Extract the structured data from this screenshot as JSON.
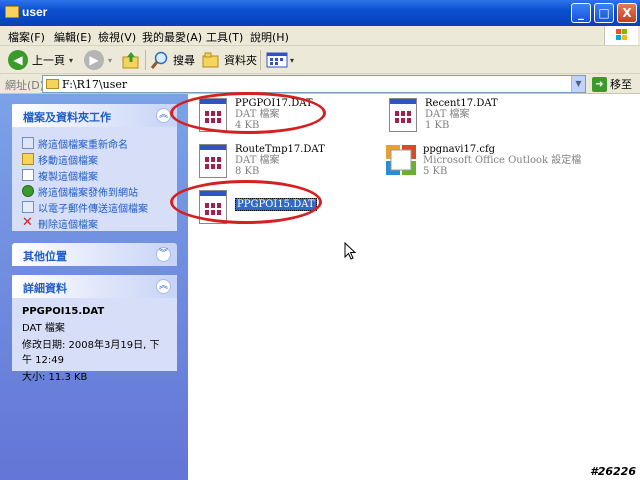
{
  "window": {
    "title": "user",
    "minimize": "_",
    "maximize": "□",
    "close": "X"
  },
  "menu": [
    "檔案(F)",
    "編輯(E)",
    "檢視(V)",
    "我的最愛(A)",
    "工具(T)",
    "說明(H)"
  ],
  "toolbar": {
    "back": "上一頁",
    "search": "搜尋",
    "folders": "資料夾"
  },
  "address": {
    "label": "網址(D)",
    "path": "F:\\R17\\user",
    "go": "移至"
  },
  "tasks_panel": {
    "title": "檔案及資料夾工作",
    "items": [
      {
        "label": "將這個檔案重新命名",
        "icon": "rename-icon"
      },
      {
        "label": "移動這個檔案",
        "icon": "move-icon"
      },
      {
        "label": "複製這個檔案",
        "icon": "copy-icon"
      },
      {
        "label": "將這個檔案發佈到網站",
        "icon": "globe-icon"
      },
      {
        "label": "以電子郵件傳送這個檔案",
        "icon": "email-icon"
      },
      {
        "label": "刪除這個檔案",
        "icon": "delete-icon"
      }
    ]
  },
  "other_places": {
    "title": "其他位置"
  },
  "details": {
    "title": "詳細資料",
    "name": "PPGPOI15.DAT",
    "type": "DAT 檔案",
    "modified": "修改日期: 2008年3月19日, 下午 12:49",
    "size": "大小: 11.3 KB"
  },
  "files": [
    {
      "name": "PPGPOI17.DAT",
      "type": "DAT 檔案",
      "size": "4 KB",
      "icon": "dat-file-icon"
    },
    {
      "name": "Recent17.DAT",
      "type": "DAT 檔案",
      "size": "1 KB",
      "icon": "dat-file-icon"
    },
    {
      "name": "RouteTmp17.DAT",
      "type": "DAT 檔案",
      "size": "8 KB",
      "icon": "dat-file-icon"
    },
    {
      "name": "ppgnavi17.cfg",
      "type": "Microsoft Office Outlook 設定檔",
      "size": "5 KB",
      "icon": "office-file-icon"
    },
    {
      "name": "PPGPOI15.DAT",
      "type": "",
      "size": "",
      "icon": "dat-file-icon",
      "selected": true
    }
  ],
  "watermark": "#26226",
  "colors": {
    "title_blue": "#0a4fd0",
    "sidebar_blue": "#6375d6",
    "link_blue": "#215dc6",
    "highlight_red": "#d42020",
    "selection_blue": "#316ac5"
  }
}
